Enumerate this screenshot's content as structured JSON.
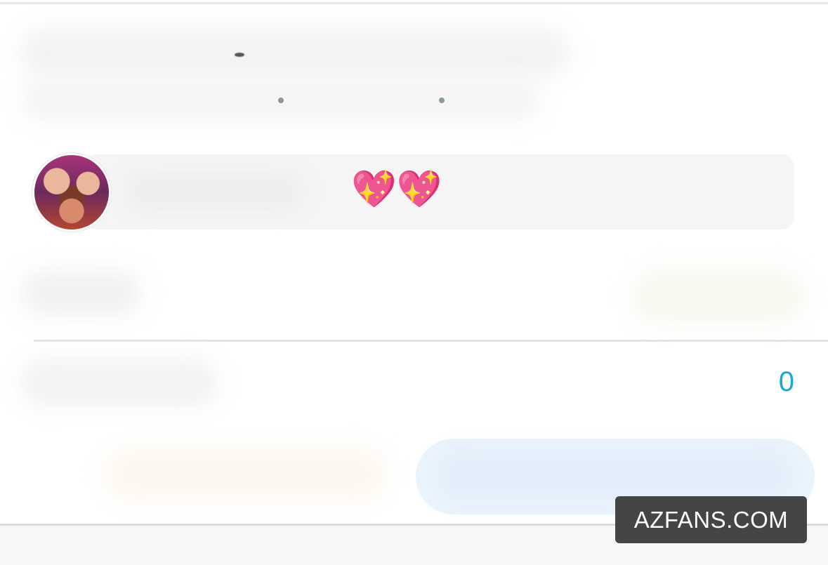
{
  "message": {
    "text": "💖💖"
  },
  "stats": {
    "count": "0"
  },
  "watermark": {
    "text": "AZFANS.COM"
  },
  "colors": {
    "accent": "#1ea6d8",
    "bubble": "#f5f5f5",
    "action_button": "#ebf4fc",
    "watermark_bg": "#444546"
  },
  "icons": {
    "avatar": "profile-photo"
  }
}
